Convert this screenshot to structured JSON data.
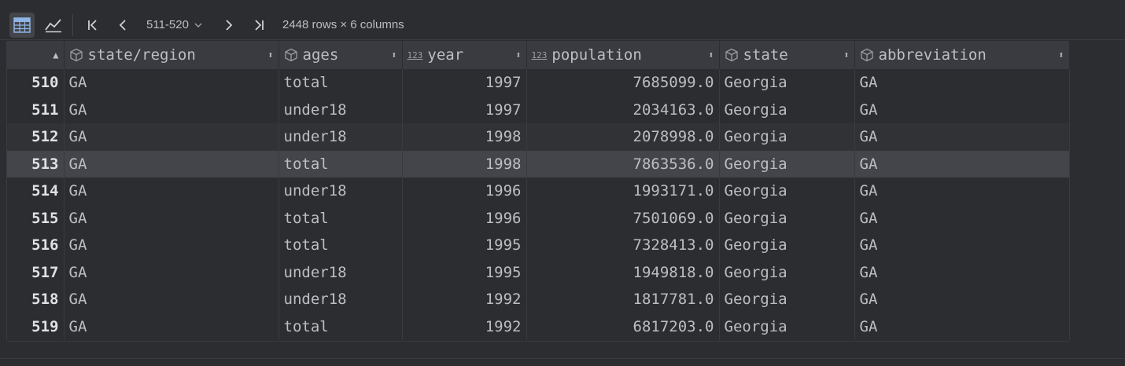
{
  "toolbar": {
    "page_range": "511-520",
    "rows_info": "2448 rows × 6 columns"
  },
  "columns": [
    {
      "label": "",
      "icon": "none"
    },
    {
      "label": "state/region",
      "icon": "object-icon"
    },
    {
      "label": "ages",
      "icon": "object-icon"
    },
    {
      "label": "year",
      "icon": "numeric-icon"
    },
    {
      "label": "population",
      "icon": "numeric-icon"
    },
    {
      "label": "state",
      "icon": "object-icon"
    },
    {
      "label": "abbreviation",
      "icon": "object-icon"
    }
  ],
  "numeric_icon_text": "123",
  "rows": [
    {
      "idx": "510",
      "region": "GA",
      "ages": "total",
      "year": "1997",
      "population": "7685099.0",
      "state": "Georgia",
      "abbr": "GA"
    },
    {
      "idx": "511",
      "region": "GA",
      "ages": "under18",
      "year": "1997",
      "population": "2034163.0",
      "state": "Georgia",
      "abbr": "GA"
    },
    {
      "idx": "512",
      "region": "GA",
      "ages": "under18",
      "year": "1998",
      "population": "2078998.0",
      "state": "Georgia",
      "abbr": "GA"
    },
    {
      "idx": "513",
      "region": "GA",
      "ages": "total",
      "year": "1998",
      "population": "7863536.0",
      "state": "Georgia",
      "abbr": "GA"
    },
    {
      "idx": "514",
      "region": "GA",
      "ages": "under18",
      "year": "1996",
      "population": "1993171.0",
      "state": "Georgia",
      "abbr": "GA"
    },
    {
      "idx": "515",
      "region": "GA",
      "ages": "total",
      "year": "1996",
      "population": "7501069.0",
      "state": "Georgia",
      "abbr": "GA"
    },
    {
      "idx": "516",
      "region": "GA",
      "ages": "total",
      "year": "1995",
      "population": "7328413.0",
      "state": "Georgia",
      "abbr": "GA"
    },
    {
      "idx": "517",
      "region": "GA",
      "ages": "under18",
      "year": "1995",
      "population": "1949818.0",
      "state": "Georgia",
      "abbr": "GA"
    },
    {
      "idx": "518",
      "region": "GA",
      "ages": "under18",
      "year": "1992",
      "population": "1817781.0",
      "state": "Georgia",
      "abbr": "GA"
    },
    {
      "idx": "519",
      "region": "GA",
      "ages": "total",
      "year": "1992",
      "population": "6817203.0",
      "state": "Georgia",
      "abbr": "GA"
    }
  ],
  "colors": {
    "background": "#2b2d30",
    "header": "#393b40",
    "selected_cell": "#214283",
    "selected_row": "#43454a"
  }
}
